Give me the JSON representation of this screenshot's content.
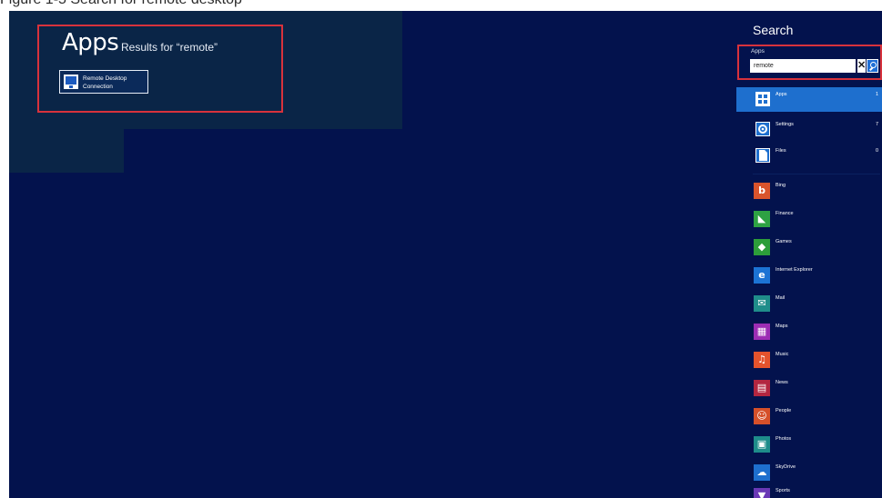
{
  "page_heading": "Figure 1-5 Search for remote desktop",
  "results": {
    "title": "Apps",
    "subtitle": "Results for “remote”",
    "tile_label": "Remote Desktop Connection",
    "tile_icon": "remote-desktop-icon"
  },
  "search": {
    "title": "Search",
    "scope_label": "Apps",
    "input_value": "remote",
    "clear_label": "✕",
    "accent": "#1e6fce",
    "highlight": "#d8323c"
  },
  "scopes": [
    {
      "label": "Apps",
      "count": "1",
      "icon": "apps-icon",
      "color": "#1e6fce"
    },
    {
      "label": "Settings",
      "count": "7",
      "icon": "gear-icon",
      "color": "#1e6fce"
    },
    {
      "label": "Files",
      "count": "0",
      "icon": "document-icon",
      "color": "#1e6fce"
    }
  ],
  "apps": [
    {
      "label": "Bing",
      "icon": "bing-icon",
      "color": "#d9542c",
      "glyph": "b"
    },
    {
      "label": "Finance",
      "icon": "finance-icon",
      "color": "#2ea243",
      "glyph": "◣"
    },
    {
      "label": "Games",
      "icon": "games-icon",
      "color": "#2d9e3a",
      "glyph": "◆"
    },
    {
      "label": "Internet Explorer",
      "icon": "internet-explorer-icon",
      "color": "#1c73d4",
      "glyph": "e"
    },
    {
      "label": "Mail",
      "icon": "mail-icon",
      "color": "#1f8d8a",
      "glyph": "✉"
    },
    {
      "label": "Maps",
      "icon": "maps-icon",
      "color": "#9c2db4",
      "glyph": "▦"
    },
    {
      "label": "Music",
      "icon": "music-icon",
      "color": "#e4532d",
      "glyph": "♫"
    },
    {
      "label": "News",
      "icon": "news-icon",
      "color": "#b32640",
      "glyph": "▤"
    },
    {
      "label": "People",
      "icon": "people-icon",
      "color": "#d6502a",
      "glyph": "☺"
    },
    {
      "label": "Photos",
      "icon": "photos-icon",
      "color": "#1e8c8a",
      "glyph": "▣"
    },
    {
      "label": "SkyDrive",
      "icon": "skydrive-icon",
      "color": "#1e6fce",
      "glyph": "☁"
    },
    {
      "label": "Sports",
      "icon": "sports-icon",
      "color": "#6a38b6",
      "glyph": "▼"
    }
  ]
}
